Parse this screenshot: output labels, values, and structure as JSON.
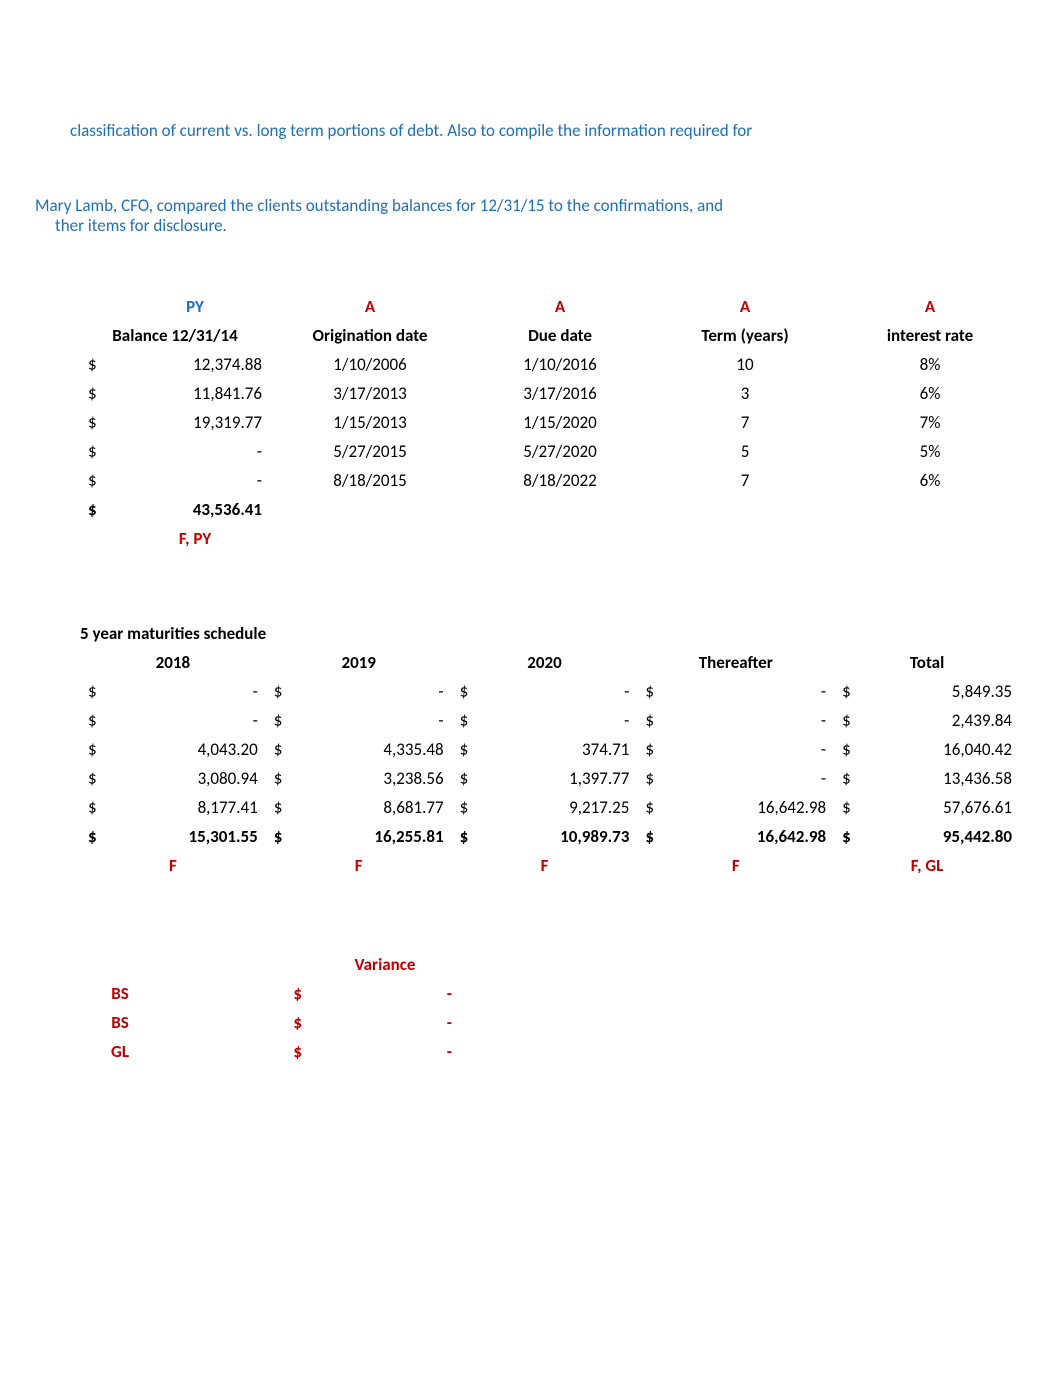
{
  "notes": {
    "line1": "classification of current vs. long term portions of debt.  Also to compile the information required for",
    "line2a": "Mary Lamb, CFO, compared the clients outstanding balances for 12/31/15 to the confirmations, and",
    "line2b": "ther items for disclosure."
  },
  "table1": {
    "tags": [
      "PY",
      "A",
      "A",
      "A",
      "A"
    ],
    "headers": [
      "Balance 12/31/14",
      "Origination date",
      "Due date",
      "Term (years)",
      "interest rate"
    ],
    "rows": [
      {
        "bal": "12,374.88",
        "orig": "1/10/2006",
        "due": "1/10/2016",
        "term": "10",
        "rate": "8%"
      },
      {
        "bal": "11,841.76",
        "orig": "3/17/2013",
        "due": "3/17/2016",
        "term": "3",
        "rate": "6%"
      },
      {
        "bal": "19,319.77",
        "orig": "1/15/2013",
        "due": "1/15/2020",
        "term": "7",
        "rate": "7%"
      },
      {
        "bal": "-",
        "orig": "5/27/2015",
        "due": "5/27/2020",
        "term": "5",
        "rate": "5%"
      },
      {
        "bal": "-",
        "orig": "8/18/2015",
        "due": "8/18/2022",
        "term": "7",
        "rate": "6%"
      }
    ],
    "total": "43,536.41",
    "footTag": "F, PY"
  },
  "table2": {
    "title": "5 year maturities schedule",
    "headers": [
      "2018",
      "2019",
      "2020",
      "Thereafter",
      "Total"
    ],
    "rows": [
      {
        "c2018": "-",
        "c2019": "-",
        "c2020": "-",
        "thereafter": "-",
        "total": "5,849.35"
      },
      {
        "c2018": "-",
        "c2019": "-",
        "c2020": "-",
        "thereafter": "-",
        "total": "2,439.84"
      },
      {
        "c2018": "4,043.20",
        "c2019": "4,335.48",
        "c2020": "374.71",
        "thereafter": "-",
        "total": "16,040.42"
      },
      {
        "c2018": "3,080.94",
        "c2019": "3,238.56",
        "c2020": "1,397.77",
        "thereafter": "-",
        "total": "13,436.58"
      },
      {
        "c2018": "8,177.41",
        "c2019": "8,681.77",
        "c2020": "9,217.25",
        "thereafter": "16,642.98",
        "total": "57,676.61"
      }
    ],
    "totals": {
      "c2018": "15,301.55",
      "c2019": "16,255.81",
      "c2020": "10,989.73",
      "thereafter": "16,642.98",
      "total": "95,442.80"
    },
    "footTags": [
      "F",
      "F",
      "F",
      "F",
      "F, GL"
    ]
  },
  "table3": {
    "header": "Variance",
    "rows": [
      {
        "label": "BS",
        "value": "-"
      },
      {
        "label": "BS",
        "value": "-"
      },
      {
        "label": "GL",
        "value": "-"
      }
    ]
  },
  "sym": {
    "dollar": "$"
  }
}
